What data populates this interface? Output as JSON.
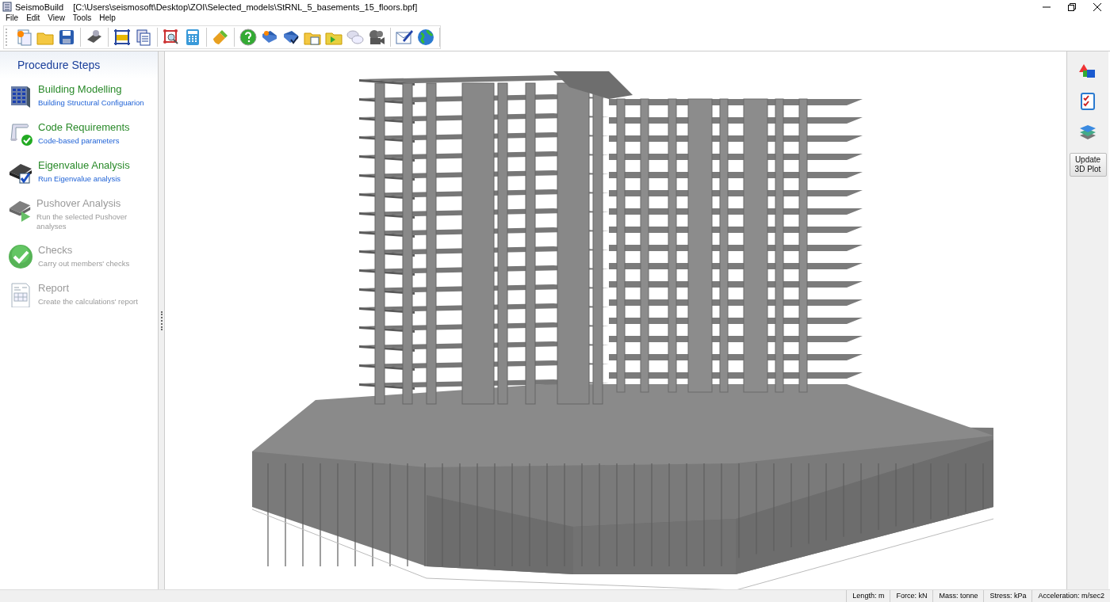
{
  "window": {
    "title": "SeismoBuild",
    "path": "[C:\\Users\\seismosoft\\Desktop\\ZOI\\Selected_models\\StRNL_5_basements_15_floors.bpf]"
  },
  "menu": [
    "File",
    "Edit",
    "View",
    "Tools",
    "Help"
  ],
  "sidebar": {
    "title": "Procedure Steps",
    "steps": [
      {
        "title": "Building Modelling",
        "subtitle": "Building Structural Configuarion",
        "disabled": false
      },
      {
        "title": "Code Requirements",
        "subtitle": "Code-based parameters",
        "disabled": false
      },
      {
        "title": "Eigenvalue Analysis",
        "subtitle": "Run Eigenvalue analysis",
        "disabled": false
      },
      {
        "title": "Pushover Analysis",
        "subtitle": "Run the selected Pushover analyses",
        "disabled": true
      },
      {
        "title": "Checks",
        "subtitle": "Carry out members' checks",
        "disabled": true
      },
      {
        "title": "Report",
        "subtitle": "Create the calculations' report",
        "disabled": true
      }
    ]
  },
  "right_panel": {
    "button": "Update 3D Plot"
  },
  "status_bar": [
    "Length: m",
    "Force: kN",
    "Mass: tonne",
    "Stress: kPa",
    "Acceleration: m/sec2"
  ]
}
